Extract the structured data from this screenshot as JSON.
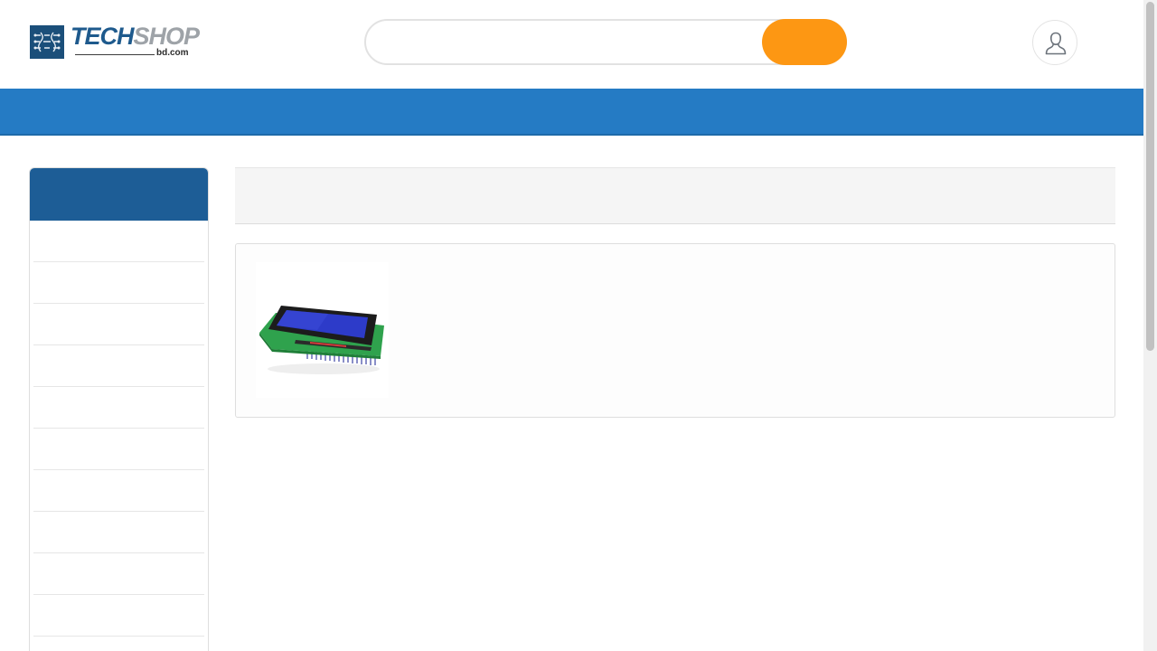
{
  "header": {
    "logo": {
      "brand_main": "TECH",
      "brand_accent": "SHOP",
      "brand_sub": "bd.com",
      "icon": "circuit-chip-icon"
    },
    "search": {
      "placeholder": "",
      "value": "",
      "button_label": ""
    },
    "account": {
      "icon": "user-icon"
    }
  },
  "navbar": {
    "items": []
  },
  "sidebar": {
    "title": "",
    "items": [
      "",
      "",
      "",
      "",
      "",
      "",
      "",
      "",
      "",
      "",
      ""
    ]
  },
  "main": {
    "title": "",
    "product": {
      "name": "",
      "image": "lcd-display-module-image"
    }
  },
  "colors": {
    "nav_blue": "#257bc4",
    "sidebar_header_blue": "#1d5d96",
    "search_button_orange": "#fd9713",
    "logo_blue": "#1e5a8d",
    "logo_gray": "#9ea3a8"
  }
}
